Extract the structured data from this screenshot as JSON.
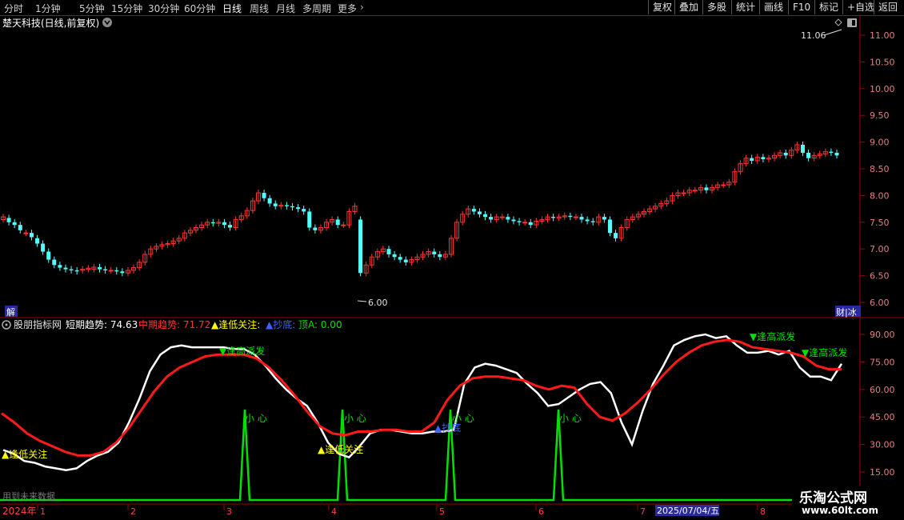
{
  "toolbar": {
    "periods": [
      "分时",
      "1分钟",
      "5分钟",
      "15分钟",
      "30分钟",
      "60分钟",
      "日线",
      "周线",
      "月线",
      "多周期",
      "更多"
    ],
    "active": "日线",
    "right_buttons": [
      "复权",
      "叠加",
      "多股",
      "统计",
      "画线",
      "F10",
      "标记",
      "+自选",
      "返回"
    ]
  },
  "main_chart": {
    "title": "楚天科技(日线,前复权)",
    "y_ticks": [
      "11.00",
      "10.50",
      "10.00",
      "9.50",
      "9.00",
      "8.50",
      "8.00",
      "7.50",
      "7.00",
      "6.50",
      "6.00"
    ],
    "high_label": "11.06",
    "low_label": "6.00",
    "left_tag": "解",
    "right_tag": "财|冰"
  },
  "indicator": {
    "name": "股朋指标网",
    "short_label": "短期趋势: 74.63",
    "mid_label": "中期趋势: 71.72",
    "low_label": "▲逢低关注:",
    "bottom_label": "▲抄底:",
    "top_label": "顶A: 0.00",
    "y_ticks": [
      "90.00",
      "75.00",
      "60.00",
      "45.00",
      "30.00",
      "15.00"
    ],
    "footnote": "用到未来数据",
    "signals": {
      "high_sell": "▼逢高派发",
      "low_watch": "▲逢低关注",
      "careful": "小 心",
      "bottom_buy": "▲抄底"
    }
  },
  "x_axis": {
    "year": "2024年",
    "months": [
      "1",
      "2",
      "3",
      "4",
      "5",
      "6",
      "7",
      "8"
    ],
    "cursor_date": "2025/07/04/五"
  },
  "watermark": {
    "line1": "乐淘公式网",
    "line2": "www.60lt.com"
  },
  "colors": {
    "up": "#ff3232",
    "down": "#54ffff",
    "short_line": "#ffffff",
    "mid_line": "#ff2020",
    "signal": "#00e000",
    "grid": "#800000",
    "accent_yellow": "#ffff00",
    "accent_blue": "#3a3aff"
  },
  "chart_data": [
    {
      "type": "candlestick",
      "title": "楚天科技(日线,前复权)",
      "ylim": [
        6.0,
        11.0
      ],
      "close": [
        7.6,
        7.5,
        7.45,
        7.35,
        7.3,
        7.22,
        7.1,
        6.95,
        6.8,
        6.7,
        6.65,
        6.62,
        6.6,
        6.58,
        6.62,
        6.64,
        6.66,
        6.62,
        6.6,
        6.6,
        6.58,
        6.55,
        6.6,
        6.65,
        6.75,
        6.9,
        7.0,
        7.05,
        7.08,
        7.1,
        7.15,
        7.2,
        7.3,
        7.35,
        7.4,
        7.45,
        7.5,
        7.48,
        7.5,
        7.45,
        7.4,
        7.55,
        7.62,
        7.72,
        7.9,
        8.05,
        7.95,
        7.85,
        7.8,
        7.82,
        7.8,
        7.78,
        7.75,
        7.7,
        7.4,
        7.35,
        7.4,
        7.5,
        7.55,
        7.45,
        7.45,
        7.7,
        7.8,
        6.55,
        6.7,
        6.85,
        6.95,
        7.0,
        6.9,
        6.85,
        6.8,
        6.75,
        6.8,
        6.85,
        6.9,
        6.95,
        6.9,
        6.85,
        6.9,
        7.2,
        7.5,
        7.65,
        7.75,
        7.7,
        7.65,
        7.6,
        7.55,
        7.6,
        7.6,
        7.55,
        7.52,
        7.5,
        7.5,
        7.45,
        7.52,
        7.55,
        7.6,
        7.58,
        7.6,
        7.62,
        7.6,
        7.6,
        7.55,
        7.52,
        7.5,
        7.6,
        7.55,
        7.3,
        7.2,
        7.4,
        7.55,
        7.6,
        7.65,
        7.7,
        7.75,
        7.8,
        7.85,
        7.9,
        8.0,
        8.05,
        8.05,
        8.1,
        8.1,
        8.15,
        8.1,
        8.15,
        8.2,
        8.2,
        8.25,
        8.45,
        8.6,
        8.7,
        8.65,
        8.72,
        8.68,
        8.7,
        8.75,
        8.8,
        8.75,
        8.85,
        8.95,
        8.8,
        8.7,
        8.75,
        8.78,
        8.82,
        8.8,
        8.75
      ],
      "open": [
        7.55,
        7.58,
        7.5,
        7.45,
        7.3,
        7.3,
        7.2,
        7.1,
        6.95,
        6.8,
        6.7,
        6.65,
        6.62,
        6.6,
        6.6,
        6.62,
        6.62,
        6.66,
        6.62,
        6.6,
        6.6,
        6.58,
        6.55,
        6.6,
        6.65,
        6.75,
        6.9,
        7.0,
        7.05,
        7.08,
        7.1,
        7.15,
        7.2,
        7.3,
        7.35,
        7.4,
        7.45,
        7.5,
        7.48,
        7.5,
        7.45,
        7.4,
        7.55,
        7.62,
        7.72,
        7.9,
        8.05,
        7.95,
        7.85,
        7.8,
        7.82,
        7.8,
        7.78,
        7.75,
        7.7,
        7.4,
        7.35,
        7.4,
        7.5,
        7.55,
        7.45,
        7.45,
        7.7,
        7.55,
        6.55,
        6.7,
        6.85,
        6.95,
        7.0,
        6.9,
        6.85,
        6.8,
        6.75,
        6.8,
        6.85,
        6.9,
        6.95,
        6.9,
        6.85,
        6.9,
        7.2,
        7.5,
        7.65,
        7.75,
        7.7,
        7.65,
        7.6,
        7.55,
        7.6,
        7.6,
        7.55,
        7.52,
        7.5,
        7.5,
        7.45,
        7.52,
        7.55,
        7.6,
        7.58,
        7.6,
        7.62,
        7.6,
        7.6,
        7.55,
        7.52,
        7.5,
        7.6,
        7.55,
        7.3,
        7.2,
        7.4,
        7.55,
        7.6,
        7.65,
        7.7,
        7.75,
        7.8,
        7.85,
        7.9,
        8.0,
        8.05,
        8.05,
        8.1,
        8.1,
        8.15,
        8.1,
        8.15,
        8.2,
        8.2,
        8.25,
        8.45,
        8.6,
        8.7,
        8.65,
        8.72,
        8.68,
        8.7,
        8.75,
        8.8,
        8.75,
        8.85,
        8.95,
        8.8,
        8.7,
        8.75,
        8.78,
        8.82,
        8.8
      ]
    },
    {
      "type": "line",
      "title": "股朋指标网",
      "ylim": [
        15,
        90
      ],
      "series": [
        {
          "name": "短期趋势",
          "values": [
            27,
            25,
            21,
            20,
            18,
            17,
            16,
            17,
            21,
            24,
            26,
            31,
            42,
            55,
            70,
            79,
            83,
            84,
            83,
            83,
            83,
            83,
            82,
            82,
            79,
            73,
            66,
            60,
            55,
            51,
            42,
            31,
            25,
            23,
            29,
            36,
            38,
            38,
            37,
            36,
            36,
            37,
            37,
            38,
            63,
            72,
            74,
            73,
            71,
            69,
            63,
            58,
            51,
            52,
            56,
            60,
            63,
            64,
            58,
            42,
            30,
            48,
            63,
            73,
            84,
            87,
            89,
            90,
            88,
            89,
            84,
            80,
            80,
            81,
            79,
            81,
            72,
            67,
            67,
            65,
            74
          ]
        },
        {
          "name": "中期趋势",
          "values": [
            47,
            42,
            36,
            32,
            29,
            26,
            24,
            24,
            26,
            31,
            39,
            49,
            59,
            67,
            72,
            75,
            78,
            79,
            79,
            79,
            77,
            72,
            65,
            57,
            48,
            40,
            36,
            35,
            37,
            37,
            38,
            38,
            37,
            37,
            42,
            54,
            62,
            66,
            67,
            67,
            66,
            65,
            62,
            60,
            62,
            61,
            52,
            45,
            43,
            47,
            53,
            60,
            68,
            75,
            80,
            84,
            86,
            87,
            86,
            83,
            82,
            81,
            80,
            78,
            73,
            71,
            71
          ]
        }
      ]
    }
  ]
}
